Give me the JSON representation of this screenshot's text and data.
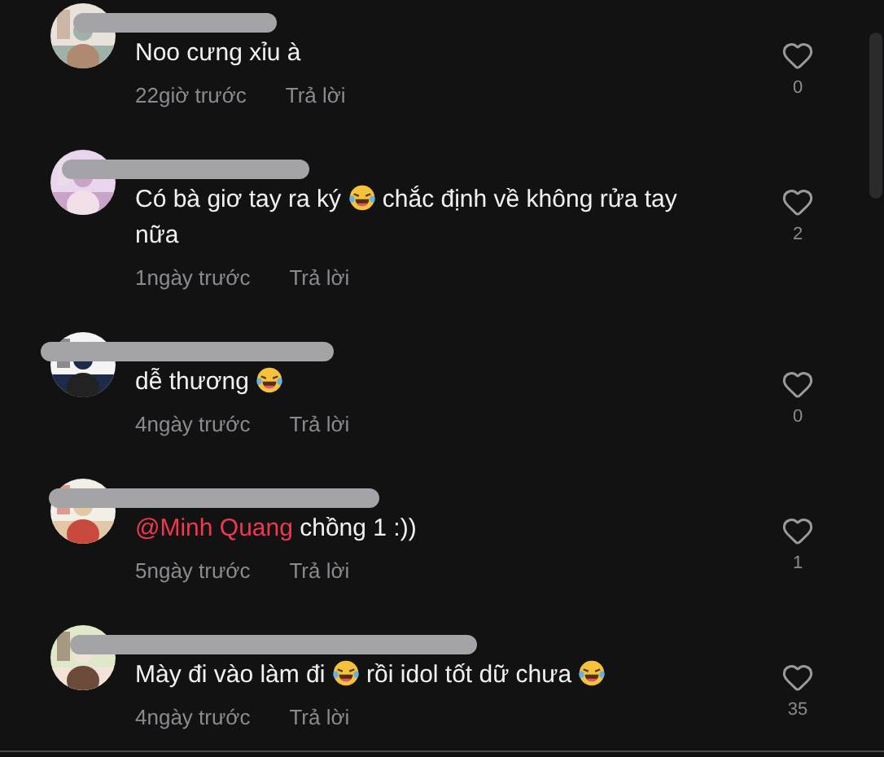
{
  "comments": [
    {
      "segments": [
        {
          "kind": "text",
          "text": "Noo cưng xỉu à"
        }
      ],
      "time": "22giờ trước",
      "reply": "Trả lời",
      "likes": "0"
    },
    {
      "segments": [
        {
          "kind": "text",
          "text": "Có bà giơ tay ra ký "
        },
        {
          "kind": "emoji"
        },
        {
          "kind": "text",
          "text": " chắc định về không rửa tay nữa"
        }
      ],
      "time": "1ngày trước",
      "reply": "Trả lời",
      "likes": "2"
    },
    {
      "segments": [
        {
          "kind": "text",
          "text": "dễ thương "
        },
        {
          "kind": "emoji"
        }
      ],
      "time": "4ngày trước",
      "reply": "Trả lời",
      "likes": "0"
    },
    {
      "segments": [
        {
          "kind": "mention",
          "text": "@Minh Quang"
        },
        {
          "kind": "text",
          "text": " chồng 1 :))"
        }
      ],
      "time": "5ngày trước",
      "reply": "Trả lời",
      "likes": "1"
    },
    {
      "segments": [
        {
          "kind": "text",
          "text": "Mày đi vào làm đi "
        },
        {
          "kind": "emoji"
        },
        {
          "kind": "text",
          "text": " rồi idol tốt dữ chưa "
        },
        {
          "kind": "emoji"
        }
      ],
      "time": "4ngày trước",
      "reply": "Trả lời",
      "likes": "35"
    }
  ]
}
